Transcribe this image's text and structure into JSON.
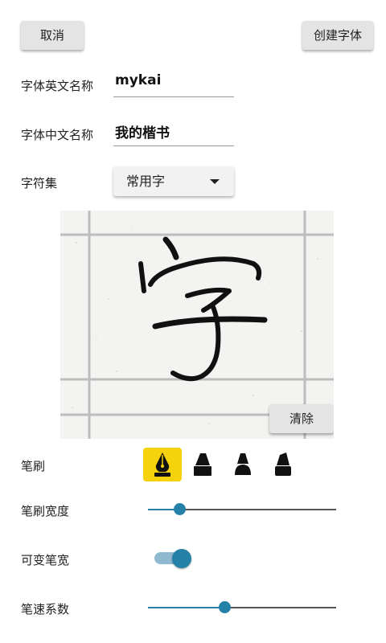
{
  "header": {
    "cancel_label": "取消",
    "create_label": "创建字体"
  },
  "form": {
    "english_name_label": "字体英文名称",
    "english_name_value": "mykai",
    "chinese_name_label": "字体中文名称",
    "chinese_name_value": "我的楷书",
    "charset_label": "字符集",
    "charset_value": "常用字"
  },
  "canvas": {
    "character": "字",
    "clear_label": "清除"
  },
  "settings": {
    "brush_label": "笔刷",
    "brush_options": [
      "pen-nib-icon",
      "marker-icon-1",
      "marker-icon-2",
      "marker-icon-3"
    ],
    "brush_selected_index": 0,
    "brush_width_label": "笔刷宽度",
    "brush_width_value": 0.17,
    "variable_width_label": "可变笔宽",
    "variable_width_on": true,
    "speed_factor_label": "笔速系数",
    "speed_factor_value": 0.41
  },
  "colors": {
    "accent": "#2581a8",
    "selected_brush_bg": "#f5d20b",
    "button_bg": "#e4e4e4"
  }
}
